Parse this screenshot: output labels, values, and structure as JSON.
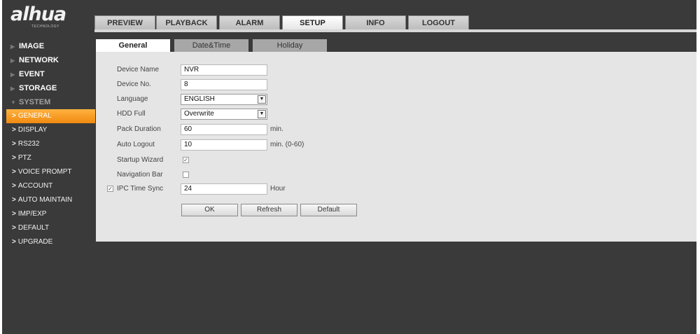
{
  "logo": {
    "brand": "alhua",
    "tagline": "TECHNOLOGY"
  },
  "topnav": [
    "PREVIEW",
    "PLAYBACK",
    "ALARM",
    "SETUP",
    "INFO",
    "LOGOUT"
  ],
  "topnav_active": "SETUP",
  "sidebar": {
    "main": [
      "IMAGE",
      "NETWORK",
      "EVENT",
      "STORAGE",
      "SYSTEM"
    ],
    "sub": [
      "GENERAL",
      "DISPLAY",
      "RS232",
      "PTZ",
      "VOICE PROMPT",
      "ACCOUNT",
      "AUTO MAINTAIN",
      "IMP/EXP",
      "DEFAULT",
      "UPGRADE"
    ],
    "active_sub": "GENERAL"
  },
  "subtabs": [
    "General",
    "Date&Time",
    "Holiday"
  ],
  "form": {
    "device_name": {
      "label": "Device Name",
      "value": "NVR"
    },
    "device_no": {
      "label": "Device No.",
      "value": "8"
    },
    "language": {
      "label": "Language",
      "value": "ENGLISH"
    },
    "hdd_full": {
      "label": "HDD Full",
      "value": "Overwrite"
    },
    "pack_duration": {
      "label": "Pack Duration",
      "value": "60",
      "unit": "min."
    },
    "auto_logout": {
      "label": "Auto Logout",
      "value": "10",
      "unit": "min. (0-60)"
    },
    "startup_wizard": {
      "label": "Startup Wizard",
      "checked": true
    },
    "navigation_bar": {
      "label": "Navigation Bar",
      "checked": false
    },
    "ipc_time_sync": {
      "label": "IPC Time Sync",
      "checked": true,
      "value": "24",
      "unit": "Hour"
    }
  },
  "buttons": {
    "ok": "OK",
    "refresh": "Refresh",
    "default": "Default"
  }
}
